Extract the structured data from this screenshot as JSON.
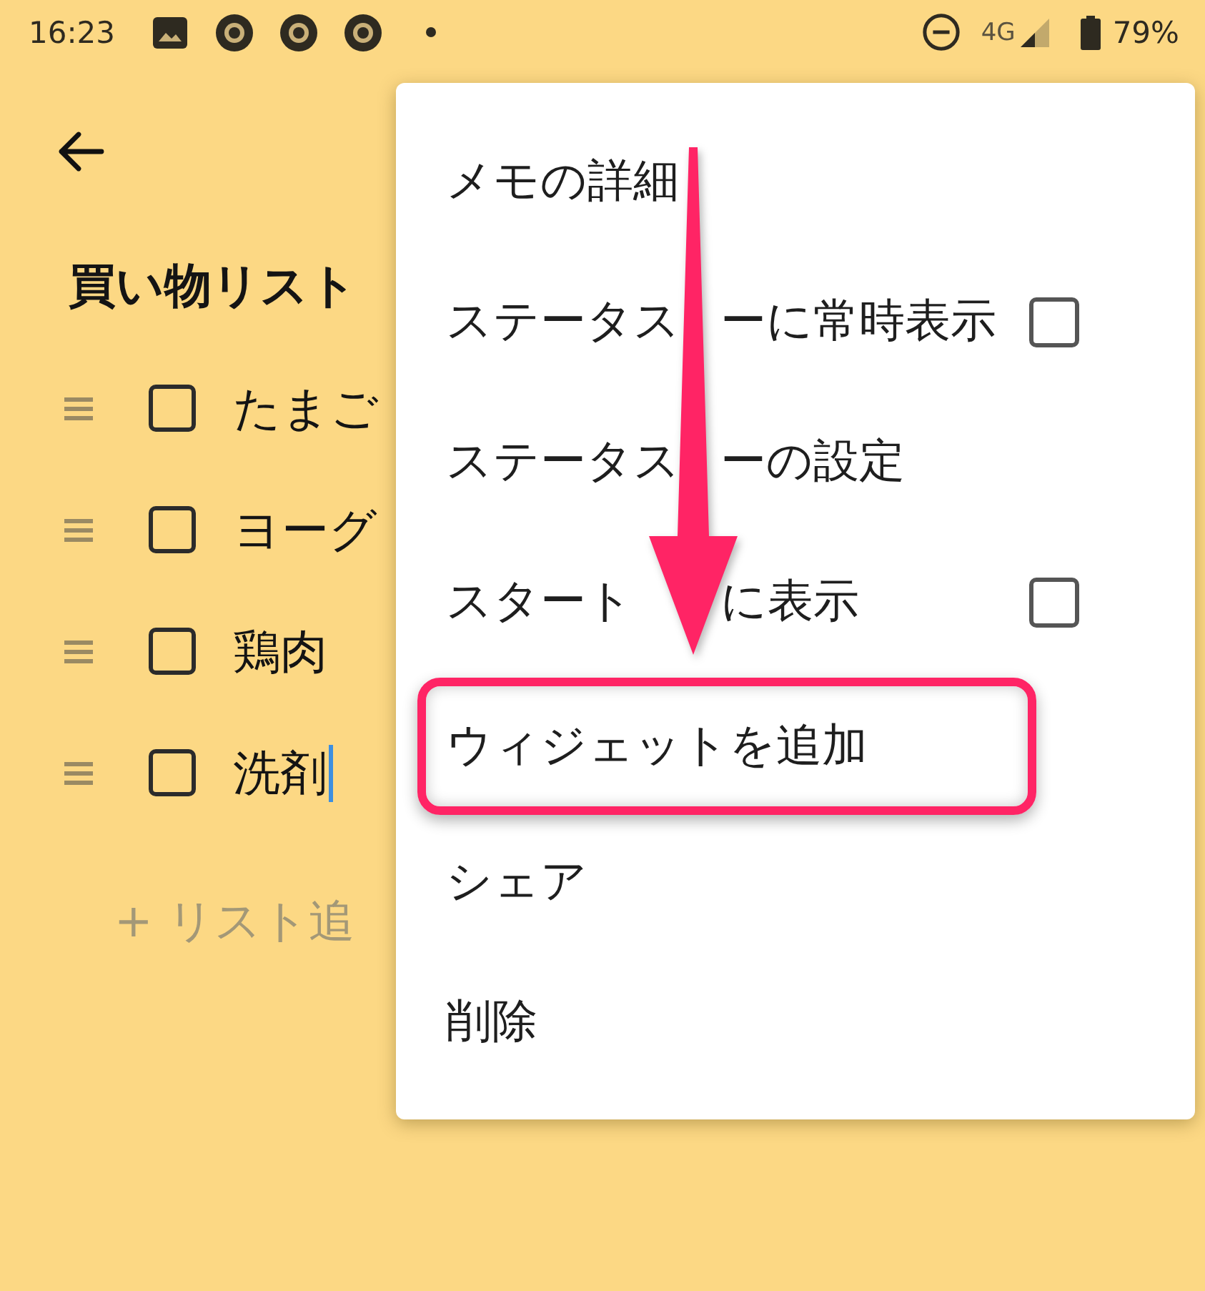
{
  "status_bar": {
    "time": "16:23",
    "network": "4G",
    "battery": "79%"
  },
  "note": {
    "title": "買い物リスト",
    "items": [
      {
        "text": "たまご",
        "checked": false,
        "editing": false
      },
      {
        "text": "ヨーグ",
        "checked": false,
        "editing": false
      },
      {
        "text": "鶏肉",
        "checked": false,
        "editing": false
      },
      {
        "text": "洗剤",
        "checked": false,
        "editing": true
      }
    ],
    "add_item": "+ リスト追"
  },
  "menu": {
    "items": [
      {
        "label": "メモの詳細",
        "kind": "plain",
        "highlighted": false
      },
      {
        "label_parts": [
          "ステータス",
          "ーに常時表示"
        ],
        "kind": "checkbox",
        "checked": false,
        "highlighted": false
      },
      {
        "label_parts": [
          "ステータス",
          "ーの設定"
        ],
        "kind": "plain",
        "highlighted": false
      },
      {
        "label_parts": [
          "スタート",
          "に表示"
        ],
        "kind": "checkbox",
        "checked": false,
        "highlighted": false
      },
      {
        "label": "ウィジェットを追加",
        "kind": "plain",
        "highlighted": true
      },
      {
        "label": "シェア",
        "kind": "plain",
        "highlighted": false
      },
      {
        "label": "削除",
        "kind": "plain",
        "highlighted": false
      }
    ]
  }
}
